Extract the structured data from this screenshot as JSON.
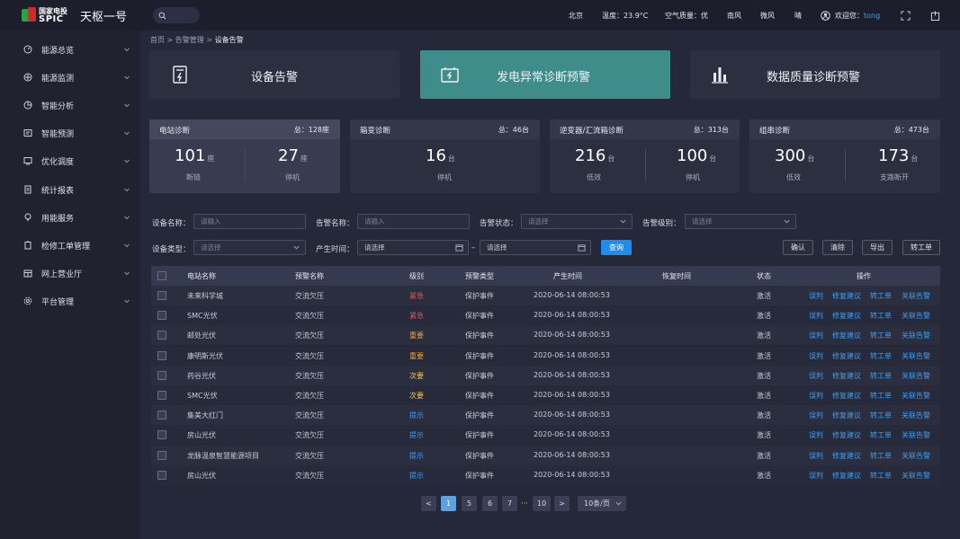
{
  "header": {
    "logo_cn": "国家电投",
    "logo_en": "SPIC",
    "app_name": "天枢一号",
    "city": "北京",
    "temperature": "温度：23.9°C",
    "air_quality": "空气质量：优",
    "wind_direction": "南风",
    "wind_strength": "微风",
    "weather": "晴",
    "welcome": "欢迎您：",
    "username": "tong"
  },
  "sidebar": {
    "items": [
      {
        "label": "能源总览",
        "icon": "dashboard-icon"
      },
      {
        "label": "能源监测",
        "icon": "monitor-icon"
      },
      {
        "label": "智能分析",
        "icon": "analysis-icon"
      },
      {
        "label": "智能预测",
        "icon": "forecast-icon"
      },
      {
        "label": "优化调度",
        "icon": "dispatch-icon"
      },
      {
        "label": "统计报表",
        "icon": "report-icon"
      },
      {
        "label": "用能服务",
        "icon": "service-icon"
      },
      {
        "label": "检修工单管理",
        "icon": "workorder-icon"
      },
      {
        "label": "网上营业厅",
        "icon": "hall-icon"
      },
      {
        "label": "平台管理",
        "icon": "settings-icon"
      }
    ]
  },
  "breadcrumb": {
    "home": "首页",
    "sep": ">",
    "parent": "告警管理",
    "current": "设备告警"
  },
  "big_cards": [
    {
      "label": "设备告警",
      "icon": "device-alarm-icon"
    },
    {
      "label": "发电异常诊断预警",
      "icon": "battery-alarm-icon"
    },
    {
      "label": "数据质量诊断预警",
      "icon": "bar-chart-icon"
    }
  ],
  "stats": [
    {
      "title": "电站诊断",
      "total": "总：128座",
      "items": [
        {
          "value": "101",
          "unit": "座",
          "label": "断链"
        },
        {
          "value": "27",
          "unit": "座",
          "label": "停机"
        }
      ]
    },
    {
      "title": "箱变诊断",
      "total": "总：46台",
      "items": [
        {
          "value": "16",
          "unit": "台",
          "label": "停机"
        }
      ]
    },
    {
      "title": "逆变器/汇流箱诊断",
      "total": "总：313台",
      "items": [
        {
          "value": "216",
          "unit": "台",
          "label": "低效"
        },
        {
          "value": "100",
          "unit": "台",
          "label": "停机"
        }
      ]
    },
    {
      "title": "组串诊断",
      "total": "总：473台",
      "items": [
        {
          "value": "300",
          "unit": "台",
          "label": "低效"
        },
        {
          "value": "173",
          "unit": "台",
          "label": "支路断开"
        }
      ]
    }
  ],
  "filters": {
    "device_name": {
      "label": "设备名称：",
      "placeholder": "请输入"
    },
    "alarm_name": {
      "label": "告警名称：",
      "placeholder": "请输入"
    },
    "alarm_status": {
      "label": "告警状态：",
      "placeholder": "请选择"
    },
    "alarm_level": {
      "label": "告警级别：",
      "placeholder": "请选择"
    },
    "device_type": {
      "label": "设备类型：",
      "placeholder": "请选择"
    },
    "time": {
      "label": "产生时间：",
      "start_placeholder": "请选择",
      "dash": "–",
      "end_placeholder": "请选择"
    },
    "query": "查询",
    "confirm": "确认",
    "clear": "清除",
    "export": "导出",
    "transfer": "转工单"
  },
  "table": {
    "headers": [
      "电站名称",
      "预警名称",
      "级别",
      "预警类型",
      "产生时间",
      "恢复时间",
      "状态",
      "操作"
    ],
    "rows": [
      {
        "station": "未来科学城",
        "name": "交流欠压",
        "level": "紧急",
        "level_class": "urgent",
        "type": "保护事件",
        "time": "2020-06-14  08:00:53",
        "recover": "",
        "status": "激活"
      },
      {
        "station": "SMC光伏",
        "name": "交流欠压",
        "level": "紧急",
        "level_class": "urgent",
        "type": "保护事件",
        "time": "2020-06-14  08:00:53",
        "recover": "",
        "status": "激活"
      },
      {
        "station": "邮处光伏",
        "name": "交流欠压",
        "level": "重要",
        "level_class": "important",
        "type": "保护事件",
        "time": "2020-06-14  08:00:53",
        "recover": "",
        "status": "激活"
      },
      {
        "station": "康明斯光伏",
        "name": "交流欠压",
        "level": "重要",
        "level_class": "important",
        "type": "保护事件",
        "time": "2020-06-14  08:00:53",
        "recover": "",
        "status": "激活"
      },
      {
        "station": "药谷光伏",
        "name": "交流欠压",
        "level": "次要",
        "level_class": "minor",
        "type": "保护事件",
        "time": "2020-06-14  08:00:53",
        "recover": "",
        "status": "激活"
      },
      {
        "station": "SMC光伏",
        "name": "交流欠压",
        "level": "次要",
        "level_class": "minor",
        "type": "保护事件",
        "time": "2020-06-14  08:00:53",
        "recover": "",
        "status": "激活"
      },
      {
        "station": "集美大红门",
        "name": "交流欠压",
        "level": "提示",
        "level_class": "tip",
        "type": "保护事件",
        "time": "2020-06-14  08:00:53",
        "recover": "",
        "status": "激活"
      },
      {
        "station": "房山光伏",
        "name": "交流欠压",
        "level": "提示",
        "level_class": "tip",
        "type": "保护事件",
        "time": "2020-06-14  08:00:53",
        "recover": "",
        "status": "激活"
      },
      {
        "station": "龙脉温泉智慧能源项目",
        "name": "交流欠压",
        "level": "提示",
        "level_class": "tip",
        "type": "保护事件",
        "time": "2020-06-14  08:00:53",
        "recover": "",
        "status": "激活"
      },
      {
        "station": "房山光伏",
        "name": "交流欠压",
        "level": "提示",
        "level_class": "tip",
        "type": "保护事件",
        "time": "2020-06-14  08:00:53",
        "recover": "",
        "status": "激活"
      }
    ],
    "actions": [
      "误判",
      "修复建议",
      "转工单",
      "关联告警"
    ]
  },
  "pager": {
    "prev": "<",
    "pages": [
      "1",
      "5",
      "6",
      "7"
    ],
    "ellipsis": "···",
    "last": "10",
    "next": ">",
    "page_size": "10条/页",
    "current": "1"
  },
  "colors": {
    "accent": "#1e8df0",
    "active_card": "#3e8d8b",
    "urgent": "#ee5350",
    "important": "#f0a236",
    "minor": "#f5c54e",
    "tip": "#3d9ef0"
  }
}
